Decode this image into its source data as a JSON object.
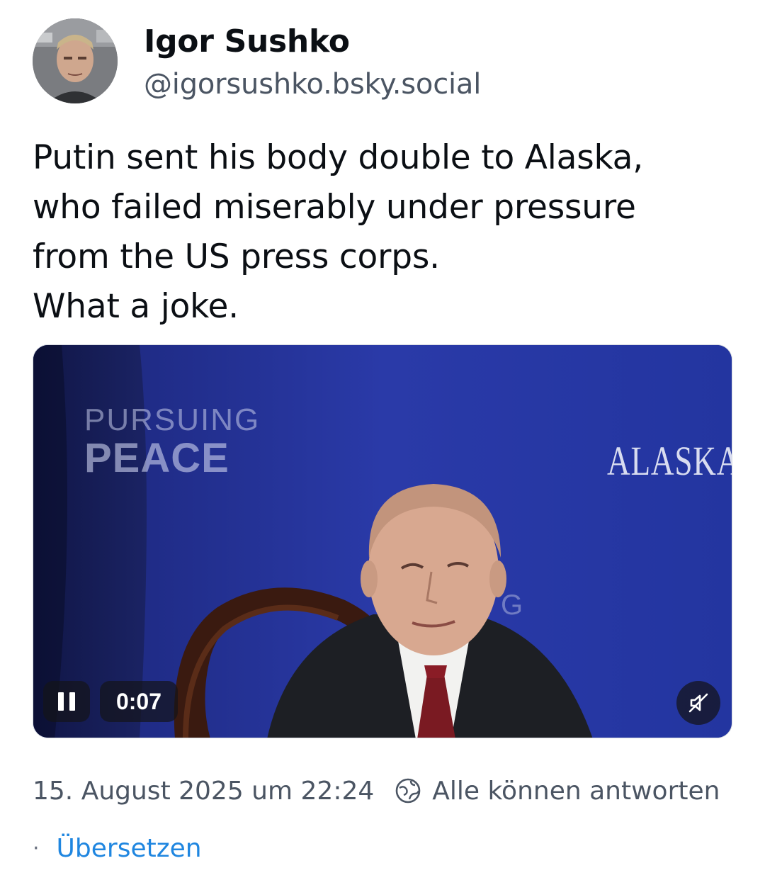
{
  "author": {
    "name": "Igor Sushko",
    "handle": "@igorsushko.bsky.social"
  },
  "post": {
    "text": "Putin sent his body double to Alaska,\nwho failed miserably under pressure\nfrom the US press corps.\nWhat a joke."
  },
  "video": {
    "sign_small": "PURSUING",
    "sign_large": "PEACE",
    "sign_alaska": "ALASKA",
    "time": "0:07",
    "pause_icon": "pause-icon",
    "mute_icon": "muted-speaker-icon"
  },
  "meta": {
    "timestamp": "15. August 2025 um 22:24",
    "reply_setting": "Alle können antworten",
    "reply_icon": "globe-icon",
    "separator": "·",
    "translate_label": "Übersetzen"
  },
  "colors": {
    "link": "#1f86e0",
    "secondary_text": "#4b5563",
    "backdrop": "#1d2a8c"
  }
}
